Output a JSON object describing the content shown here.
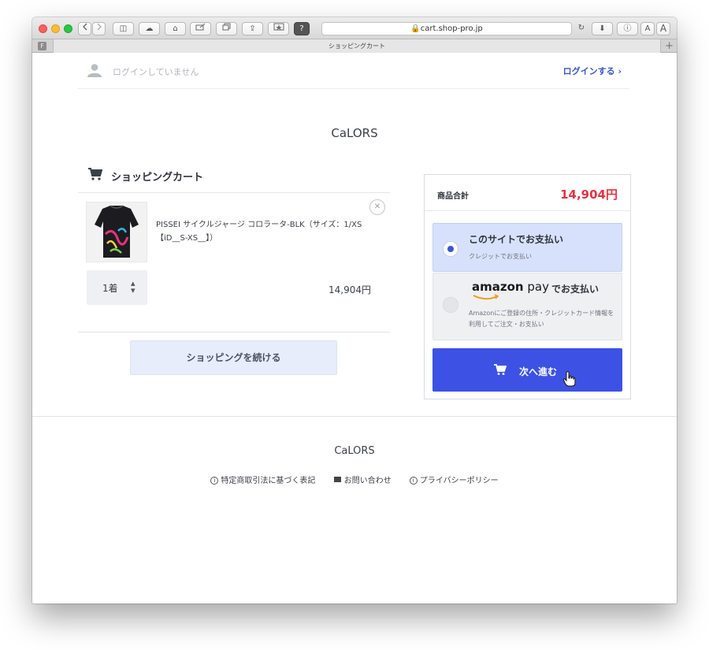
{
  "browser": {
    "address": "cart.shop-pro.jp",
    "tab_title": "ショッピングカート",
    "sidebar_btn": "◫",
    "cloud_btn": "☁",
    "home_btn": "⌂",
    "share_btn": "⇪",
    "help_btn": "?",
    "reload_btn": "↻",
    "download_btn": "⬇",
    "info_btn": "ⓘ",
    "text_small": "A",
    "text_large": "A",
    "new_tab": "+",
    "favicon": "F"
  },
  "header": {
    "login_status": "ログインしていません",
    "login_link": "ログインする ›"
  },
  "store": {
    "title": "CaLORS"
  },
  "cart": {
    "heading": "ショッピングカート",
    "items": [
      {
        "name": "PISSEI サイクルジャージ コロラータ-BLK（サイズ：1/XS【iD__S-XS__】）",
        "quantity": "1着",
        "price": "14,904円"
      }
    ],
    "continue_label": "ショッピングを続ける"
  },
  "summary": {
    "total_label": "商品合計",
    "total_value": "14,904円",
    "payment_options": [
      {
        "title": "このサイトでお支払い",
        "subtitle": "クレジットでお支払い",
        "selected": true
      },
      {
        "logo_bold": "amazon",
        "logo_light": " pay",
        "title": "でお支払い",
        "subtitle": "Amazonにご登録の住所・クレジットカード情報を利用してご注文・お支払い",
        "selected": false
      }
    ],
    "next_label": "次へ進む"
  },
  "footer": {
    "brand": "CaLORS",
    "links": [
      "特定商取引法に基づく表記",
      "お問い合わせ",
      "プライバシーポリシー"
    ]
  },
  "colors": {
    "accent": "#3d52e5",
    "price_red": "#e8323f",
    "selected_option": "#d7e1fb"
  }
}
